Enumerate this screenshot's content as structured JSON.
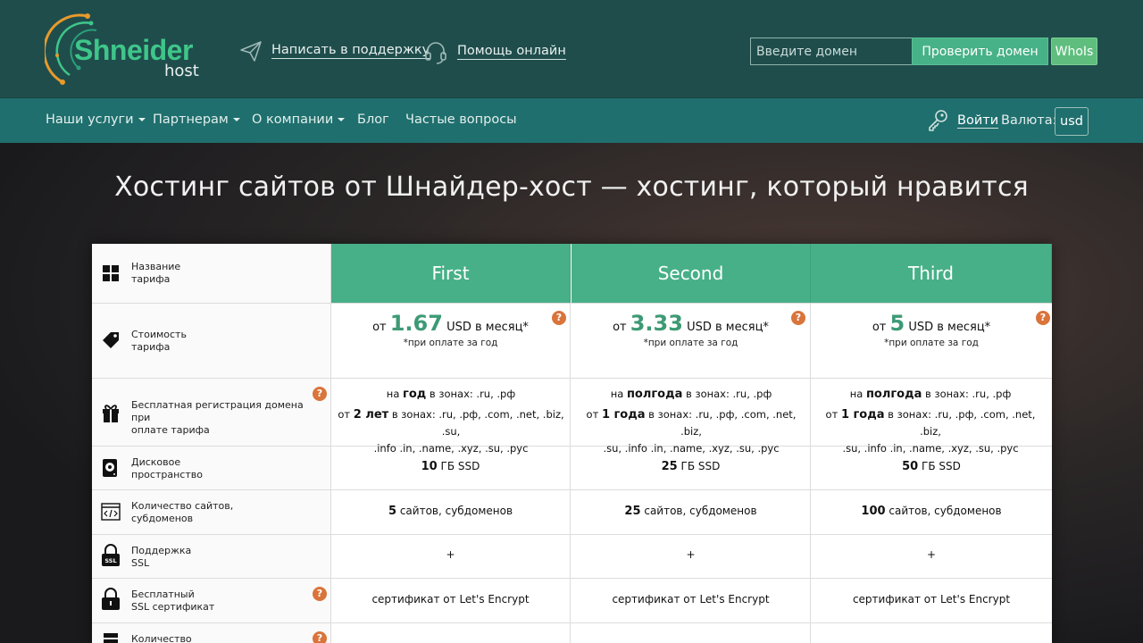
{
  "header": {
    "logo_main": "Shneider",
    "logo_sub": "host",
    "support_link": "Написать в поддержку",
    "help_link": "Помощь онлайн",
    "domain_placeholder": "Введите домен",
    "check_button": "Проверить домен",
    "whois_button": "WhoIs"
  },
  "nav": {
    "items": [
      {
        "label": "Наши услуги",
        "dropdown": true
      },
      {
        "label": "Партнерам",
        "dropdown": true
      },
      {
        "label": "О компании",
        "dropdown": true
      },
      {
        "label": "Блог",
        "dropdown": false
      },
      {
        "label": "Частые вопросы",
        "dropdown": false
      }
    ],
    "login": "Войти",
    "currency_label": "Валюта:",
    "currency_value": "usd"
  },
  "hero": {
    "title": "Хостинг сайтов от Шнайдер-хост — хостинг, который нравится"
  },
  "table": {
    "rows": [
      {
        "label1": "Название",
        "label2": "тарифа"
      },
      {
        "label1": "Стоимость",
        "label2": "тарифа"
      },
      {
        "label1": "Бесплатная регистрация домена при",
        "label2": "оплате тарифа"
      },
      {
        "label1": "Дисковое",
        "label2": "пространство"
      },
      {
        "label1": "Количество сайтов,",
        "label2": "субдоменов"
      },
      {
        "label1": "Поддержка",
        "label2": "SSL"
      },
      {
        "label1": "Бесплатный",
        "label2": "SSL сертификат"
      },
      {
        "label1": "Количество",
        "label2": ""
      }
    ],
    "help_mark": "?",
    "plans": [
      {
        "name": "First",
        "price_prefix": "от",
        "price": "1.67",
        "price_suffix": "USD в месяц*",
        "price_note": "*при оплате за год",
        "dom_a_pre": "на",
        "dom_a_bold": "год",
        "dom_a_post": "в зонах: .ru, .рф",
        "dom_b_pre": "от",
        "dom_b_bold": "2 лет",
        "dom_b_post": "в зонах: .ru, .рф, .com, .net, .biz, .su,",
        "dom_b_line2": ".info .in, .name, .xyz, .su, .рус",
        "disk": "10",
        "disk_unit": "ГБ SSD",
        "sites": "5",
        "sites_unit": "сайтов, субдоменов",
        "ssl": "+",
        "free_ssl": "сертификат от Let's Encrypt"
      },
      {
        "name": "Second",
        "price_prefix": "от",
        "price": "3.33",
        "price_suffix": "USD в месяц*",
        "price_note": "*при оплате за год",
        "dom_a_pre": "на",
        "dom_a_bold": "полгода",
        "dom_a_post": "в зонах: .ru, .рф",
        "dom_b_pre": "от",
        "dom_b_bold": "1 года",
        "dom_b_post": "в зонах: .ru, .рф, .com, .net, .biz,",
        "dom_b_line2": ".su, .info .in, .name, .xyz, .su, .рус",
        "disk": "25",
        "disk_unit": "ГБ SSD",
        "sites": "25",
        "sites_unit": "сайтов, субдоменов",
        "ssl": "+",
        "free_ssl": "сертификат от Let's Encrypt"
      },
      {
        "name": "Third",
        "price_prefix": "от",
        "price": "5",
        "price_suffix": "USD в месяц*",
        "price_note": "*при оплате за год",
        "dom_a_pre": "на",
        "dom_a_bold": "полгода",
        "dom_a_post": "в зонах: .ru, .рф",
        "dom_b_pre": "от",
        "dom_b_bold": "1 года",
        "dom_b_post": "в зонах: .ru, .рф, .com, .net, .biz,",
        "dom_b_line2": ".su, .info .in, .name, .xyz, .su, .рус",
        "disk": "50",
        "disk_unit": "ГБ SSD",
        "sites": "100",
        "sites_unit": "сайтов, субдоменов",
        "ssl": "+",
        "free_ssl": "сертификат от Let's Encrypt"
      }
    ]
  },
  "colors": {
    "topbar": "#1f4d4c",
    "navbar": "#1f6f6e",
    "accent_green": "#47b088",
    "price_green": "#3d9a75",
    "help_orange": "#d9743b"
  }
}
